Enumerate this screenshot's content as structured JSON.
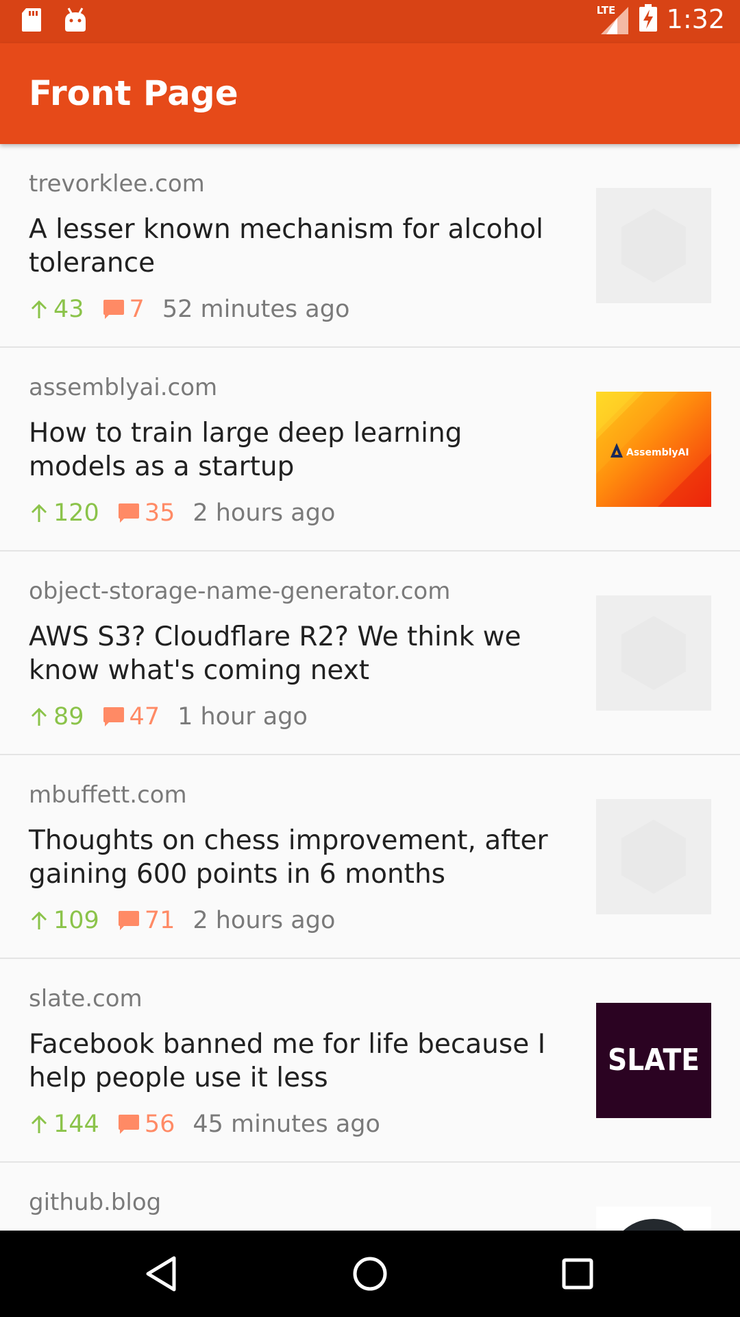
{
  "status_bar": {
    "time": "1:32",
    "network_label": "LTE",
    "icons": [
      "sd-card-icon",
      "android-icon",
      "lte-signal-icon",
      "battery-charging-icon"
    ]
  },
  "app_bar": {
    "title": "Front Page"
  },
  "colors": {
    "status_bar": "#d84315",
    "app_bar": "#e64a19",
    "score": "#8bc34a",
    "comments": "#ff8a65"
  },
  "items": [
    {
      "domain": "trevorklee.com",
      "title": "A lesser known mechanism for alcohol tolerance",
      "score": "43",
      "comments": "7",
      "time": "52 minutes ago",
      "thumb": "placeholder"
    },
    {
      "domain": "assemblyai.com",
      "title": "How to train large deep learning models as a startup",
      "score": "120",
      "comments": "35",
      "time": "2 hours ago",
      "thumb": "assemblyai",
      "thumb_text": "AssemblyAI"
    },
    {
      "domain": "object-storage-name-generator.com",
      "title": "AWS S3? Cloudflare R2? We think we know what's coming next",
      "score": "89",
      "comments": "47",
      "time": "1 hour ago",
      "thumb": "placeholder"
    },
    {
      "domain": "mbuffett.com",
      "title": "Thoughts on chess improvement, after gaining 600 points in 6 months",
      "score": "109",
      "comments": "71",
      "time": "2 hours ago",
      "thumb": "placeholder"
    },
    {
      "domain": "slate.com",
      "title": "Facebook banned me for life because I help people use it less",
      "score": "144",
      "comments": "56",
      "time": "45 minutes ago",
      "thumb": "slate",
      "thumb_text": "SLATE"
    },
    {
      "domain": "github.blog",
      "title": "",
      "score": "",
      "comments": "",
      "time": "",
      "thumb": "github"
    }
  ],
  "nav": {
    "icons": [
      "back-icon",
      "home-icon",
      "recents-icon"
    ]
  }
}
